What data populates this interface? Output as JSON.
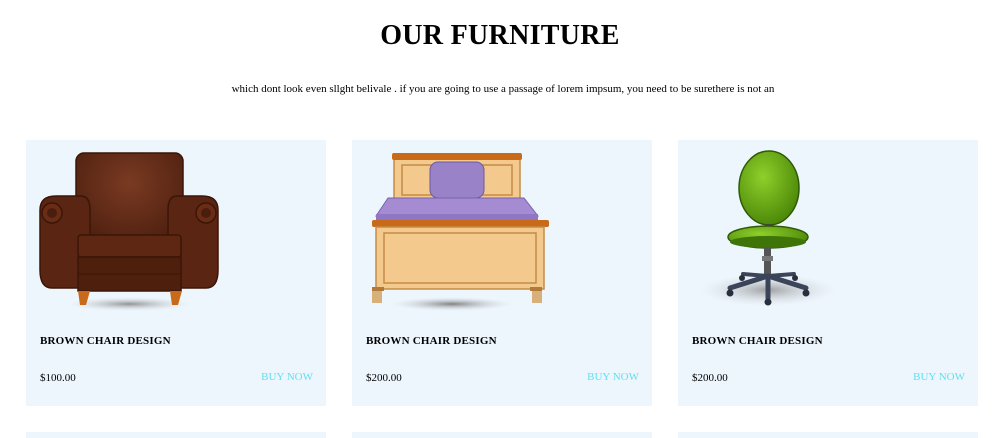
{
  "section": {
    "heading": "OUR FURNITURE",
    "subtitle": "which dont look even sllght belivale . if you are going to use a passage of lorem impsum, you need to be surethere is not an"
  },
  "products": [
    {
      "title": "BROWN CHAIR DESIGN",
      "price": "$100.00",
      "buy_label": "BUY NOW",
      "image": "armchair-image"
    },
    {
      "title": "BROWN CHAIR DESIGN",
      "price": "$200.00",
      "buy_label": "BUY NOW",
      "image": "bed-image"
    },
    {
      "title": "BROWN CHAIR DESIGN",
      "price": "$200.00",
      "buy_label": "BUY NOW",
      "image": "office-chair-image"
    }
  ],
  "colors": {
    "card_background": "#eef6fd",
    "buy_link": "#5fe0f0",
    "heading": "#000000"
  }
}
